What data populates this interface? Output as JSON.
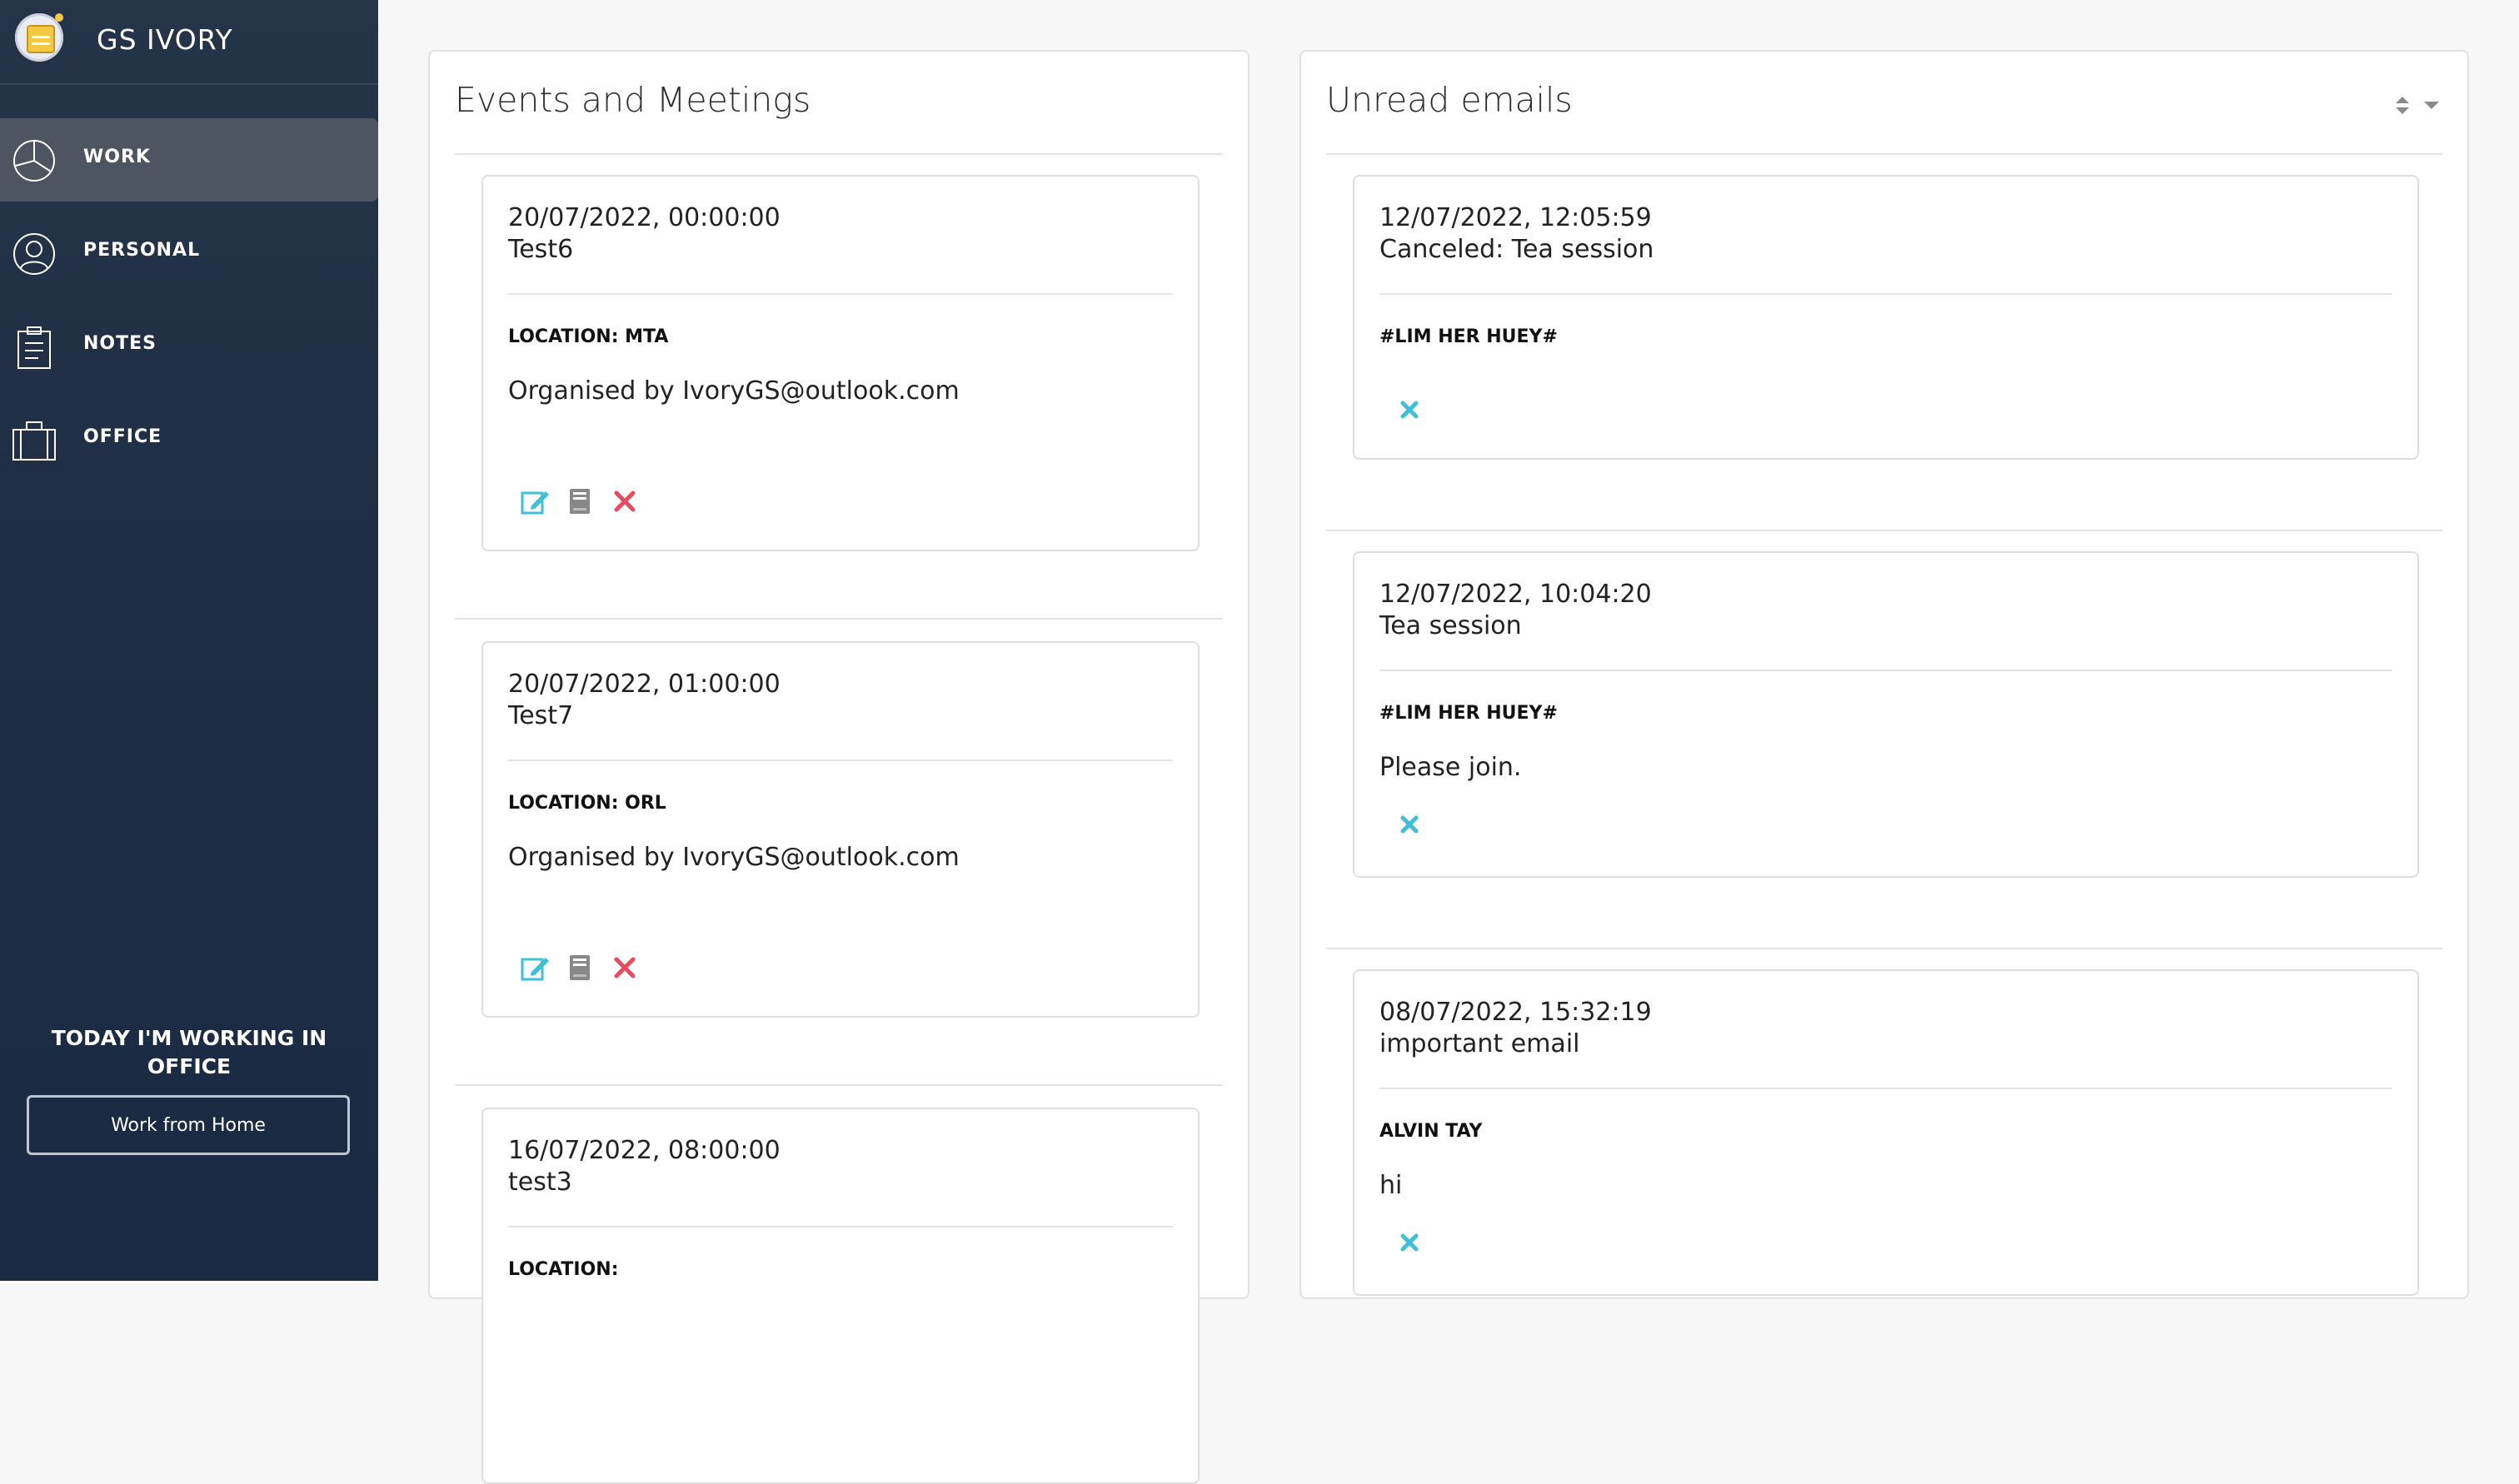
{
  "app": {
    "title": "GS IVORY"
  },
  "sidebar": {
    "items": [
      {
        "label": "WORK",
        "icon": "pie-chart-icon",
        "active": true
      },
      {
        "label": "PERSONAL",
        "icon": "user-icon",
        "active": false
      },
      {
        "label": "NOTES",
        "icon": "clipboard-icon",
        "active": false
      },
      {
        "label": "OFFICE",
        "icon": "briefcase-icon",
        "active": false
      }
    ],
    "status": "TODAY I'M WORKING IN OFFICE",
    "toggle_button": "Work from Home"
  },
  "events": {
    "title": "Events and Meetings",
    "items": [
      {
        "datetime": "20/07/2022, 00:00:00",
        "name": "Test6",
        "location": "LOCATION: MTA",
        "organiser": "Organised by IvoryGS@outlook.com"
      },
      {
        "datetime": "20/07/2022, 01:00:00",
        "name": "Test7",
        "location": "LOCATION: ORL",
        "organiser": "Organised by IvoryGS@outlook.com"
      },
      {
        "datetime": "16/07/2022, 08:00:00",
        "name": "test3",
        "location": "LOCATION:",
        "organiser": ""
      }
    ]
  },
  "emails": {
    "title": "Unread emails",
    "items": [
      {
        "datetime": "12/07/2022, 12:05:59",
        "subject": "Canceled: Tea session",
        "sender": "#LIM HER HUEY#",
        "body": ""
      },
      {
        "datetime": "12/07/2022, 10:04:20",
        "subject": "Tea session",
        "sender": "#LIM HER HUEY#",
        "body": "Please join."
      },
      {
        "datetime": "08/07/2022, 15:32:19",
        "subject": "important email",
        "sender": "ALVIN TAY",
        "body": "hi"
      }
    ]
  },
  "colors": {
    "sidebar_bg": "#1f2e45",
    "active_item": "#4d5562",
    "edit_icon": "#3fbfd8",
    "book_icon": "#888888",
    "delete_icon": "#e84a5f",
    "dismiss_icon": "#3fbfd8"
  }
}
